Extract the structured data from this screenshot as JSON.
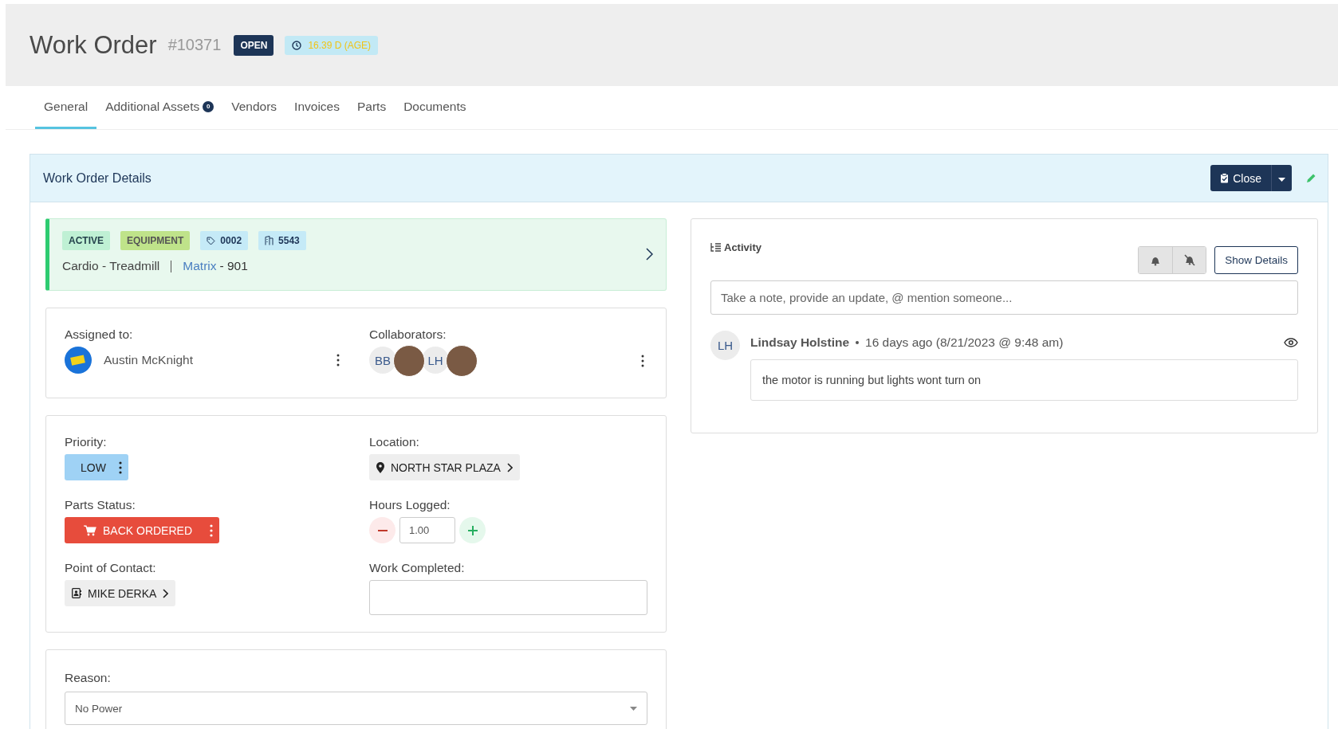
{
  "header": {
    "title": "Work Order",
    "number": "#10371",
    "status": "OPEN",
    "age": "16.39 D (AGE)"
  },
  "tabs": [
    {
      "label": "General",
      "selected": true
    },
    {
      "label": "Additional Assets",
      "selected": false,
      "count": "0"
    },
    {
      "label": "Vendors",
      "selected": false
    },
    {
      "label": "Invoices",
      "selected": false
    },
    {
      "label": "Parts",
      "selected": false
    },
    {
      "label": "Documents",
      "selected": false
    }
  ],
  "panel": {
    "title": "Work Order Details",
    "close_button": "Close"
  },
  "asset": {
    "tags": [
      {
        "kind": "status",
        "text": "ACTIVE"
      },
      {
        "kind": "category",
        "text": "EQUIPMENT"
      },
      {
        "kind": "tag",
        "text": "0002"
      },
      {
        "kind": "building",
        "text": "5543"
      }
    ],
    "name": "Cardio - Treadmill",
    "brand": "Matrix",
    "model": "- 901"
  },
  "assignment": {
    "assigned_label": "Assigned to:",
    "assignee": "Austin McKnight",
    "collaborators_label": "Collaborators:",
    "collaborators": [
      {
        "kind": "initials",
        "text": "BB"
      },
      {
        "kind": "photo"
      },
      {
        "kind": "initials",
        "text": "LH"
      },
      {
        "kind": "photo"
      }
    ]
  },
  "details": {
    "priority": {
      "label": "Priority:",
      "value": "LOW"
    },
    "location": {
      "label": "Location:",
      "value": "NORTH STAR PLAZA"
    },
    "parts_status": {
      "label": "Parts Status:",
      "value": "BACK ORDERED"
    },
    "hours": {
      "label": "Hours Logged:",
      "value": "1.00"
    },
    "contact": {
      "label": "Point of Contact:",
      "value": "MIKE DERKA"
    },
    "work_completed": {
      "label": "Work Completed:"
    }
  },
  "reason": {
    "label": "Reason:",
    "value": "No Power"
  },
  "activity": {
    "title": "Activity",
    "show_details": "Show Details",
    "note_placeholder": "Take a note, provide an update, @ mention someone...",
    "entries": [
      {
        "initials": "LH",
        "author": "Lindsay Holstine",
        "time": "16 days ago (8/21/2023 @ 9:48 am)",
        "text": "the motor is running but lights wont turn on"
      }
    ]
  }
}
